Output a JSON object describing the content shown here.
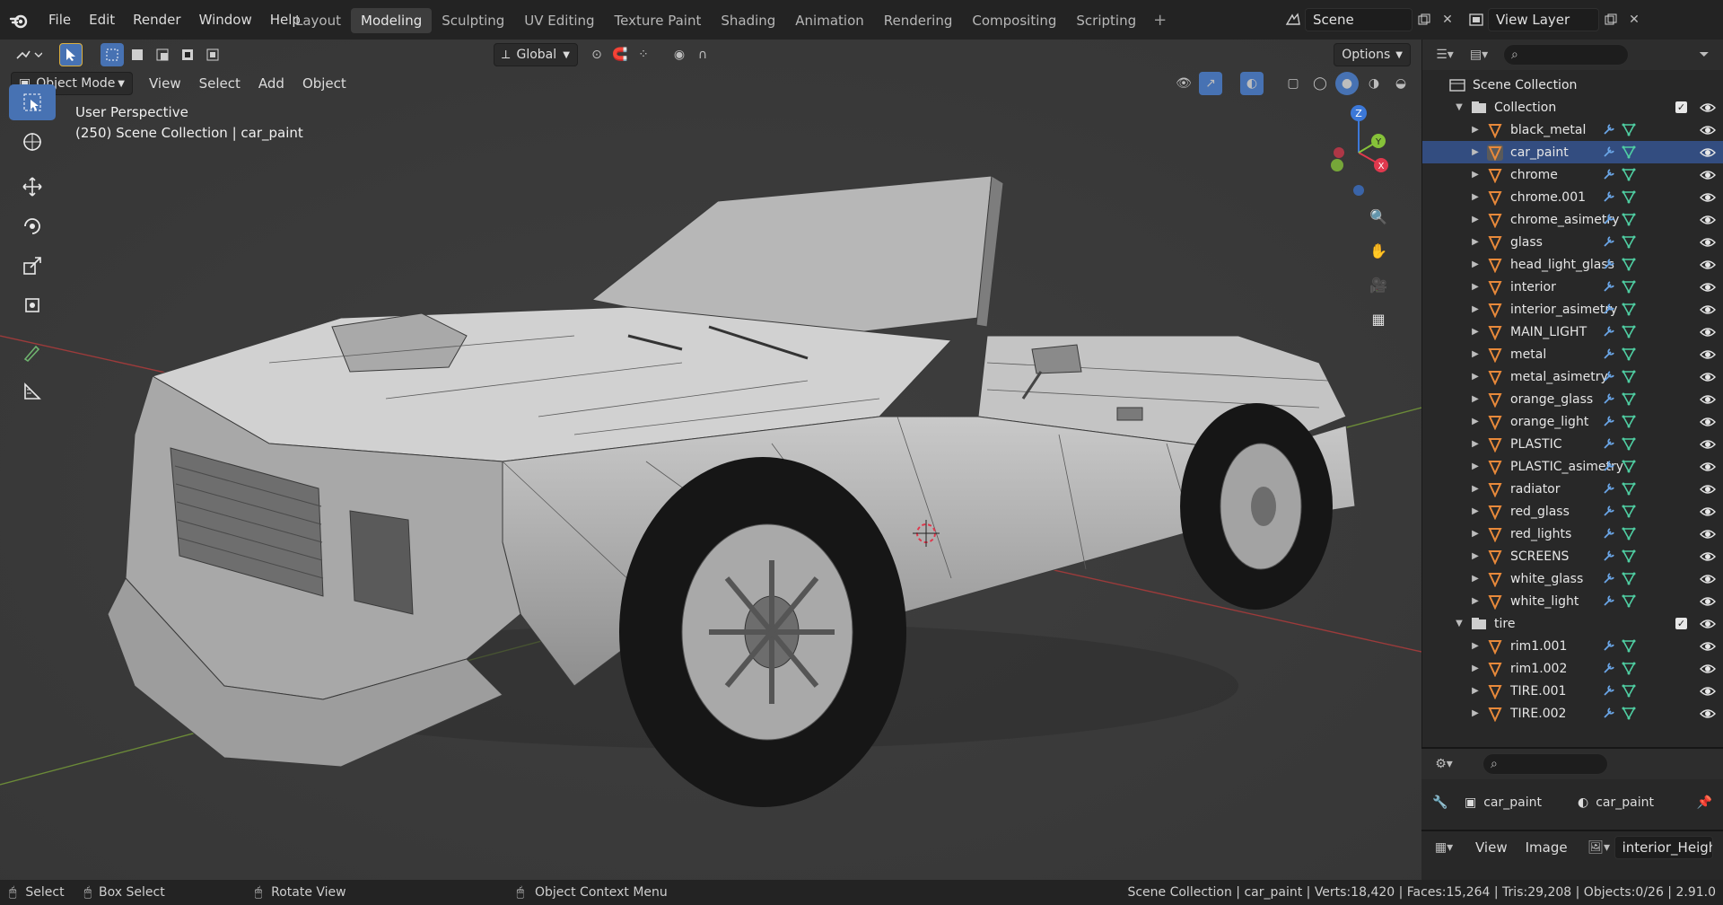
{
  "app": {
    "menus": [
      "File",
      "Edit",
      "Render",
      "Window",
      "Help"
    ],
    "workspaces": [
      "Layout",
      "Modeling",
      "Sculpting",
      "UV Editing",
      "Texture Paint",
      "Shading",
      "Animation",
      "Rendering",
      "Compositing",
      "Scripting"
    ],
    "active_workspace": "Modeling",
    "scene_name": "Scene",
    "view_layer": "View Layer"
  },
  "viewport": {
    "transform_orientation": "Global",
    "options_label": "Options",
    "mode": "Object Mode",
    "menus": [
      "View",
      "Select",
      "Add",
      "Object"
    ],
    "perspective": "User Perspective",
    "context_line": "(250) Scene Collection | car_paint",
    "gizmo_axes": {
      "z": "Z",
      "x": "X",
      "y": "Y"
    },
    "colors": {
      "accent": "#4772b3",
      "axis_x": "#e0384d",
      "axis_y": "#86c239",
      "axis_z": "#3c78d8"
    }
  },
  "outliner": {
    "root": "Scene Collection",
    "collections": [
      {
        "name": "Collection",
        "objects": [
          "black_metal",
          "car_paint",
          "chrome",
          "chrome.001",
          "chrome_asimetry",
          "glass",
          "head_light_glass",
          "interior",
          "interior_asimetry",
          "MAIN_LIGHT",
          "metal",
          "metal_asimetry",
          "orange_glass",
          "orange_light",
          "PLASTIC",
          "PLASTIC_asimetry",
          "radiator",
          "red_glass",
          "red_lights",
          "SCREENS",
          "white_glass",
          "white_light"
        ]
      },
      {
        "name": "tire",
        "objects": [
          "rim1.001",
          "rim1.002",
          "TIRE.001",
          "TIRE.002"
        ]
      }
    ],
    "selected_object": "car_paint"
  },
  "properties": {
    "object_name": "car_paint",
    "data_name": "car_paint"
  },
  "image_editor": {
    "menus": [
      "View",
      "Image"
    ],
    "image_name": "interior_Height.p"
  },
  "status": {
    "hints": [
      "Select",
      "Box Select",
      "Rotate View",
      "Object Context Menu"
    ],
    "info": "Scene Collection | car_paint | Verts:18,420 | Faces:15,264 | Tris:29,208 | Objects:0/26 | 2.91.0"
  }
}
